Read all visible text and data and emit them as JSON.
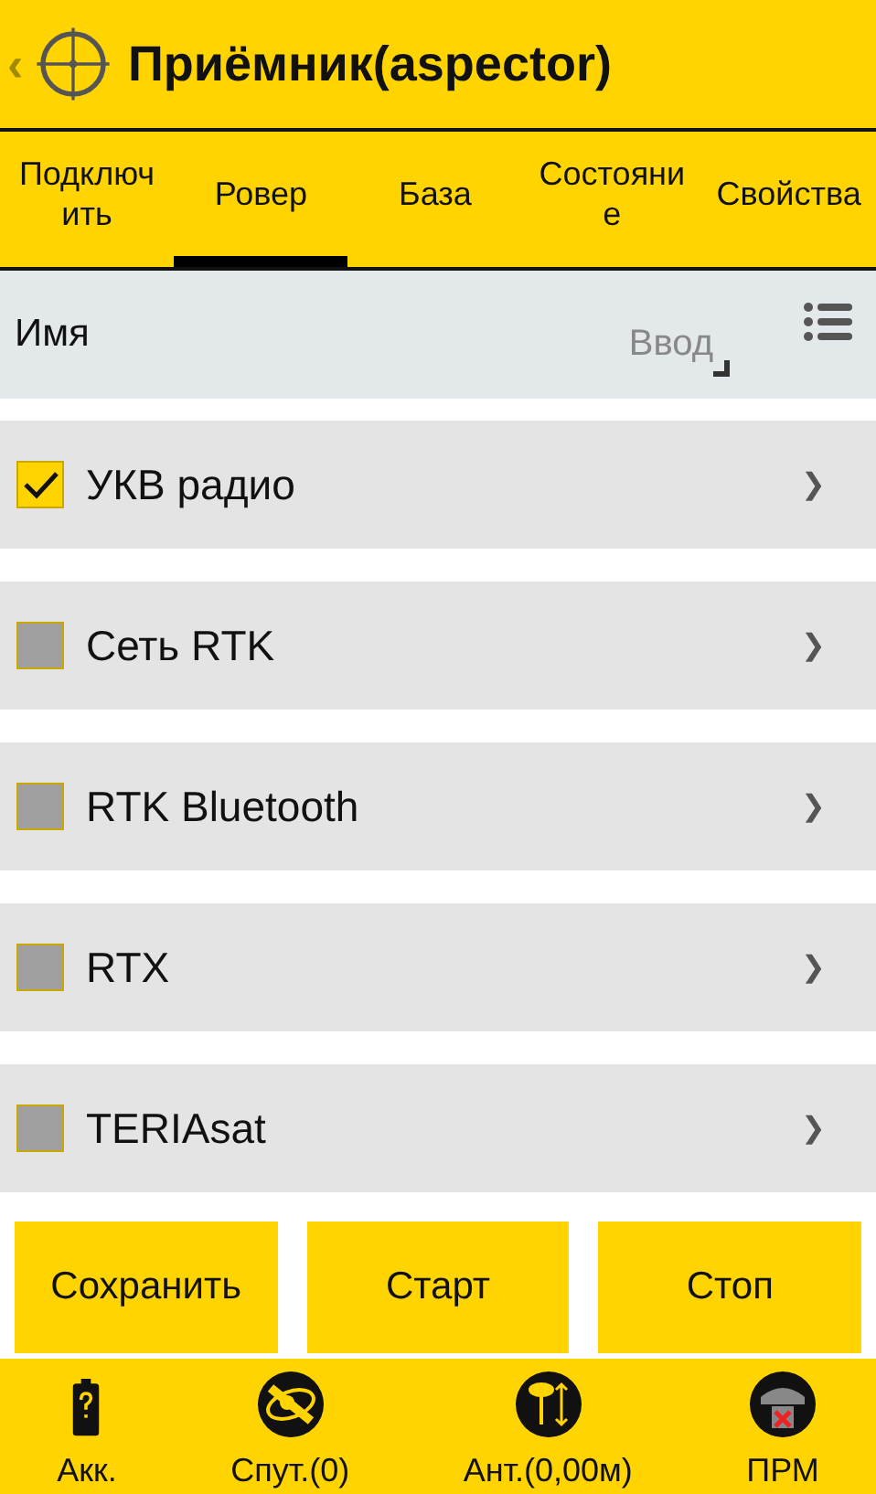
{
  "header": {
    "back": "‹",
    "title": "Приёмник(aspector)"
  },
  "tabs": [
    {
      "label": "Подключ ить",
      "selected": false
    },
    {
      "label": "Ровер",
      "selected": true
    },
    {
      "label": "База",
      "selected": false
    },
    {
      "label": "Состояни е",
      "selected": false
    },
    {
      "label": "Свойства",
      "selected": false
    }
  ],
  "name_row": {
    "label": "Имя",
    "placeholder": "Ввод"
  },
  "items": [
    {
      "label": "УКВ радио",
      "checked": true,
      "chevron": "❯"
    },
    {
      "label": "Сеть RTK",
      "checked": false,
      "chevron": "❯"
    },
    {
      "label": "RTK Bluetooth",
      "checked": false,
      "chevron": "❯"
    },
    {
      "label": "RTX",
      "checked": false,
      "chevron": "❯"
    },
    {
      "label": "TERIAsat",
      "checked": false,
      "chevron": "❯"
    }
  ],
  "buttons": [
    "Сохранить",
    "Старт",
    "Стоп"
  ],
  "status_bar": [
    {
      "kind": "battery",
      "label": "Акк."
    },
    {
      "kind": "satellite",
      "label": "Спут.(0)"
    },
    {
      "kind": "antenna",
      "label": "Ант.(0,00м)"
    },
    {
      "kind": "receiver",
      "label": "ПРМ"
    }
  ]
}
